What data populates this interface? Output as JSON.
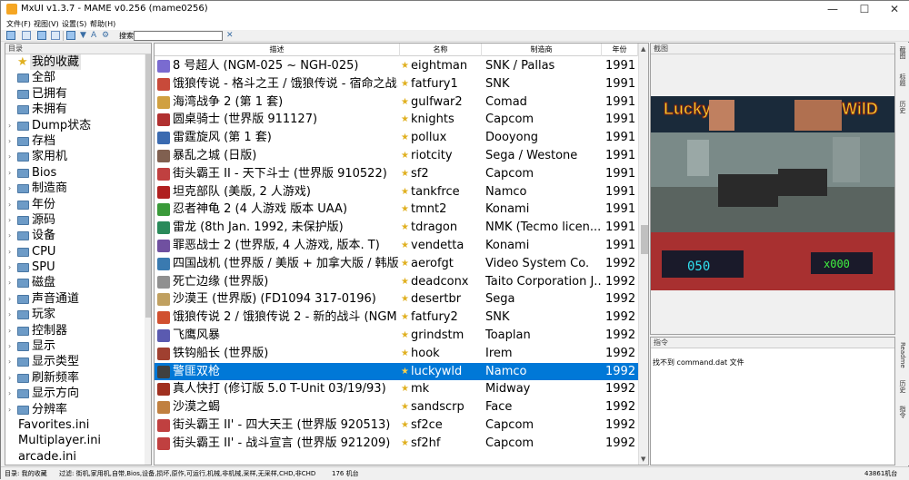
{
  "window": {
    "title": "MxUI v1.3.7 - MAME v0.256 (mame0256)",
    "min": "—",
    "max": "☐",
    "close": "✕"
  },
  "menu": [
    "文件(F)",
    "视图(V)",
    "设置(S)",
    "帮助(H)"
  ],
  "toolbar": {
    "search_label": "搜索:",
    "search_value": ""
  },
  "tree": {
    "header": "目录",
    "items": [
      {
        "label": "我的收藏",
        "icon": "star",
        "selected": true
      },
      {
        "label": "全部"
      },
      {
        "label": "已拥有"
      },
      {
        "label": "未拥有"
      },
      {
        "label": "Dump状态",
        "expand": true
      },
      {
        "label": "存档",
        "expand": true
      },
      {
        "label": "家用机",
        "expand": true
      },
      {
        "label": "Bios",
        "expand": true
      },
      {
        "label": "制造商",
        "expand": true
      },
      {
        "label": "年份",
        "expand": true
      },
      {
        "label": "源码",
        "expand": true
      },
      {
        "label": "设备",
        "expand": true
      },
      {
        "label": "CPU",
        "expand": true
      },
      {
        "label": "SPU",
        "expand": true
      },
      {
        "label": "磁盘",
        "expand": true
      },
      {
        "label": "声音通道",
        "expand": true
      },
      {
        "label": "玩家",
        "expand": true
      },
      {
        "label": "控制器",
        "expand": true
      },
      {
        "label": "显示",
        "expand": true
      },
      {
        "label": "显示类型",
        "expand": true
      },
      {
        "label": "刷新频率",
        "expand": true
      },
      {
        "label": "显示方向",
        "expand": true
      },
      {
        "label": "分辨率",
        "expand": true
      },
      {
        "label": "Favorites.ini",
        "plain": true
      },
      {
        "label": "Multiplayer.ini",
        "plain": true
      },
      {
        "label": "arcade.ini",
        "plain": true
      }
    ]
  },
  "list": {
    "columns": [
      "描述",
      "名称",
      "制造商",
      "年份"
    ],
    "rows": [
      {
        "desc": "8 号超人 (NGM-025 ~ NGH-025)",
        "name": "eightman",
        "maker": "SNK / Pallas",
        "year": "1991",
        "color": "#7a6bd0"
      },
      {
        "desc": "饿狼传说 - 格斗之王 / 饿狼传说 - 宿命之战...",
        "name": "fatfury1",
        "maker": "SNK",
        "year": "1991",
        "color": "#c84a3a"
      },
      {
        "desc": "海湾战争 2 (第 1 套)",
        "name": "gulfwar2",
        "maker": "Comad",
        "year": "1991",
        "color": "#d0a040"
      },
      {
        "desc": "圆桌骑士 (世界版 911127)",
        "name": "knights",
        "maker": "Capcom",
        "year": "1991",
        "color": "#b03030"
      },
      {
        "desc": "雷霆旋风 (第 1 套)",
        "name": "pollux",
        "maker": "Dooyong",
        "year": "1991",
        "color": "#3a6ab0"
      },
      {
        "desc": "暴乱之城 (日版)",
        "name": "riotcity",
        "maker": "Sega / Westone",
        "year": "1991",
        "color": "#806050"
      },
      {
        "desc": "街头霸王 II - 天下斗士 (世界版 910522)",
        "name": "sf2",
        "maker": "Capcom",
        "year": "1991",
        "color": "#c04040"
      },
      {
        "desc": "坦克部队 (美版, 2 人游戏)",
        "name": "tankfrce",
        "maker": "Namco",
        "year": "1991",
        "color": "#b02020"
      },
      {
        "desc": "忍者神龟 2 (4 人游戏 版本 UAA)",
        "name": "tmnt2",
        "maker": "Konami",
        "year": "1991",
        "color": "#3a9a3a"
      },
      {
        "desc": "雷龙 (8th Jan. 1992, 未保护版)",
        "name": "tdragon",
        "maker": "NMK (Tecmo licen...",
        "year": "1991",
        "color": "#2a8a5a"
      },
      {
        "desc": "罪恶战士 2 (世界版, 4 人游戏, 版本. T)",
        "name": "vendetta",
        "maker": "Konami",
        "year": "1991",
        "color": "#7050a0"
      },
      {
        "desc": "四国战机 (世界版 / 美版 + 加拿大版 / 韩版 ...",
        "name": "aerofgt",
        "maker": "Video System Co.",
        "year": "1992",
        "color": "#3a7ab0"
      },
      {
        "desc": "死亡边缘 (世界版)",
        "name": "deadconx",
        "maker": "Taito Corporation J...",
        "year": "1992",
        "color": "#909090"
      },
      {
        "desc": "沙漠王 (世界版) (FD1094 317-0196)",
        "name": "desertbr",
        "maker": "Sega",
        "year": "1992",
        "color": "#c0a060"
      },
      {
        "desc": "饿狼传说 2 / 饿狼传说 2 - 新的战斗 (NGM...",
        "name": "fatfury2",
        "maker": "SNK",
        "year": "1992",
        "color": "#d05030"
      },
      {
        "desc": "飞鹰风暴",
        "name": "grindstm",
        "maker": "Toaplan",
        "year": "1992",
        "color": "#5a5ab0"
      },
      {
        "desc": "铁钩船长 (世界版)",
        "name": "hook",
        "maker": "Irem",
        "year": "1992",
        "color": "#a04030"
      },
      {
        "desc": "警匪双枪",
        "name": "luckywld",
        "maker": "Namco",
        "year": "1992",
        "color": "#404040",
        "selected": true
      },
      {
        "desc": "真人快打 (修订版 5.0 T-Unit 03/19/93)",
        "name": "mk",
        "maker": "Midway",
        "year": "1992",
        "color": "#a03020"
      },
      {
        "desc": "沙漠之蝎",
        "name": "sandscrp",
        "maker": "Face",
        "year": "1992",
        "color": "#c08040"
      },
      {
        "desc": "街头霸王 II' - 四大天王 (世界版 920513)",
        "name": "sf2ce",
        "maker": "Capcom",
        "year": "1992",
        "color": "#c04040"
      },
      {
        "desc": "街头霸王 II' - 战斗宣言 (世界版 921209)",
        "name": "sf2hf",
        "maker": "Capcom",
        "year": "1992",
        "color": "#c04040"
      }
    ]
  },
  "preview": {
    "header": "截图",
    "logo_left": "Lucky",
    "logo_right": "WilD",
    "hud": "050",
    "hud_right": "x000"
  },
  "command": {
    "header": "指令",
    "text": "找不到 command.dat 文件"
  },
  "side_tabs": [
    "截图",
    "标题",
    "历史",
    "Readme",
    "历史",
    "指令"
  ],
  "status": {
    "dir": "目录: 我的收藏",
    "filter": "过滤: 街机,家用机,自带,Bios,设备,损坏,原作,可运行,机械,非机械,采样,无采样,CHD,非CHD",
    "count": "176 机台",
    "zoom": "43861机台"
  }
}
